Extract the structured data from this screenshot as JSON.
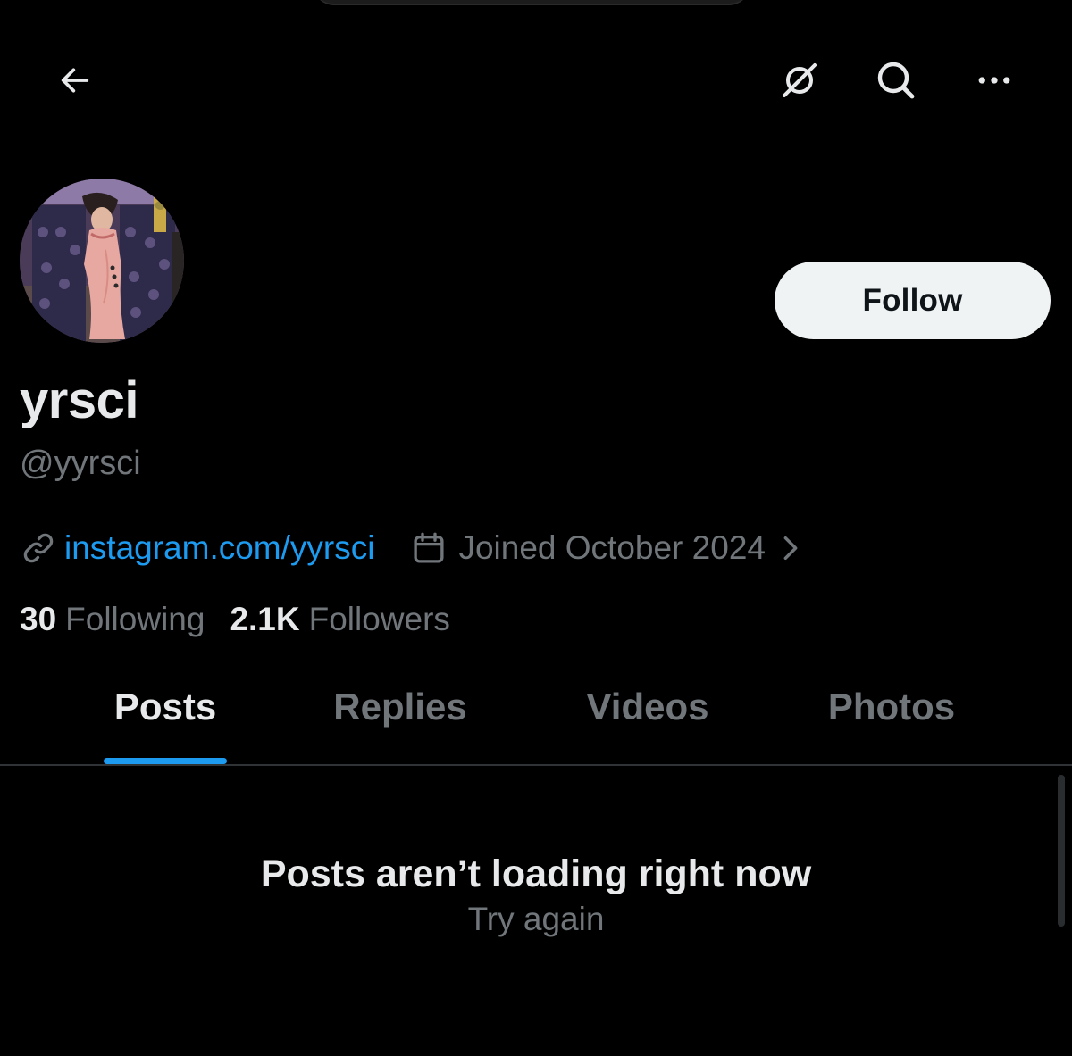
{
  "topbar": {
    "back_icon": "arrow-left-icon",
    "grok_icon": "grok-icon",
    "search_icon": "search-icon",
    "more_icon": "more-horizontal-icon"
  },
  "profile": {
    "avatar": "profile-avatar",
    "display_name": "yrsci",
    "handle": "@yyrsci",
    "follow_label": "Follow",
    "link_icon": "link-icon",
    "website": "instagram.com/yyrsci",
    "calendar_icon": "calendar-icon",
    "joined": "Joined October 2024",
    "chevron_icon": "chevron-right-icon",
    "stats": {
      "following_count": "30",
      "following_label": "Following",
      "followers_count": "2.1K",
      "followers_label": "Followers"
    }
  },
  "tabs": [
    {
      "label": "Posts",
      "active": true
    },
    {
      "label": "Replies",
      "active": false
    },
    {
      "label": "Videos",
      "active": false
    },
    {
      "label": "Photos",
      "active": false
    }
  ],
  "empty_state": {
    "title": "Posts aren’t loading right now",
    "retry_label": "Try again"
  },
  "colors": {
    "background": "#000000",
    "primary_text": "#e7e9ea",
    "secondary_text": "#71767b",
    "accent": "#1d9bf0",
    "follow_button_bg": "#eff3f4",
    "divider": "#2f3336"
  }
}
